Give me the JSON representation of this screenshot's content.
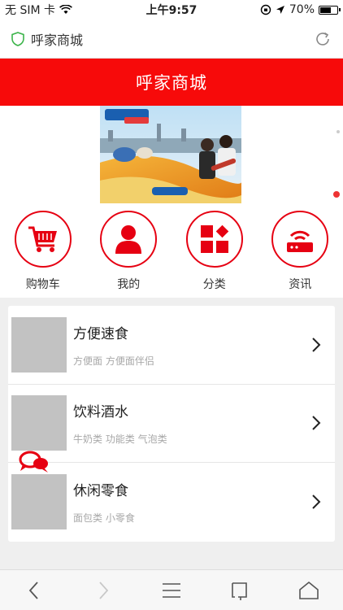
{
  "status_bar": {
    "carrier": "无 SIM 卡",
    "time": "上午9:57",
    "battery": "70%",
    "battery_level": 0.7
  },
  "browser": {
    "page_title": "呼家商城"
  },
  "header": {
    "title": "呼家商城"
  },
  "nav_icons": [
    {
      "label": "购物车",
      "icon": "cart-icon"
    },
    {
      "label": "我的",
      "icon": "user-icon"
    },
    {
      "label": "分类",
      "icon": "category-icon"
    },
    {
      "label": "资讯",
      "icon": "router-icon"
    }
  ],
  "categories": [
    {
      "title": "方便速食",
      "subtitle": "方便面 方便面伴侣"
    },
    {
      "title": "饮料酒水",
      "subtitle": "牛奶类 功能类 气泡类"
    },
    {
      "title": "休闲零食",
      "subtitle": "面包类 小零食"
    }
  ],
  "colors": {
    "brand_red": "#f70a0a",
    "icon_red": "#e60012"
  }
}
